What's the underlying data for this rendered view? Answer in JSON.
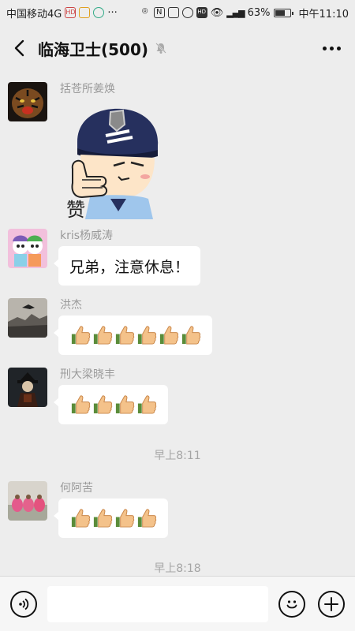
{
  "status_bar": {
    "carrier": "中国移动4G",
    "battery": "63%",
    "time": "中午11:10",
    "icons": [
      "hd-icon",
      "sim-icon",
      "nfc-icon",
      "vibrate-icon",
      "alarm-icon",
      "eye-icon",
      "signal-icon",
      "battery-icon"
    ]
  },
  "header": {
    "title": "临海卫士(500)",
    "back_icon": "chevron-left-icon",
    "mute_icon": "bell-off-icon",
    "more_icon": "more-dots-icon"
  },
  "messages": [
    {
      "sender": "括苍所姜焕",
      "type": "sticker",
      "avatar": "tiger"
    },
    {
      "sender": "kris杨威涛",
      "type": "text",
      "text": "兄弟，注意休息！",
      "avatar": "cartoon"
    },
    {
      "sender": "洪杰",
      "type": "emoji",
      "emoji": "thumbs-up-icon",
      "count": 6,
      "avatar": "landscape"
    },
    {
      "sender": "刑大梁晓丰",
      "type": "emoji",
      "emoji": "thumbs-up-icon",
      "count": 4,
      "avatar": "figure"
    },
    {
      "type": "timestamp",
      "text": "早上8:11"
    },
    {
      "sender": "何阿苦",
      "type": "emoji",
      "emoji": "thumbs-up-icon",
      "count": 4,
      "avatar": "group"
    },
    {
      "type": "timestamp",
      "text": "早上8:18"
    }
  ],
  "sticker_text": "赞",
  "input_bar": {
    "voice_icon": "voice-icon",
    "emoji_icon": "emoji-icon",
    "plus_icon": "plus-icon",
    "placeholder": ""
  },
  "colors": {
    "background": "#ededed",
    "bubble": "#ffffff",
    "meta_text": "#9a9a9a"
  }
}
